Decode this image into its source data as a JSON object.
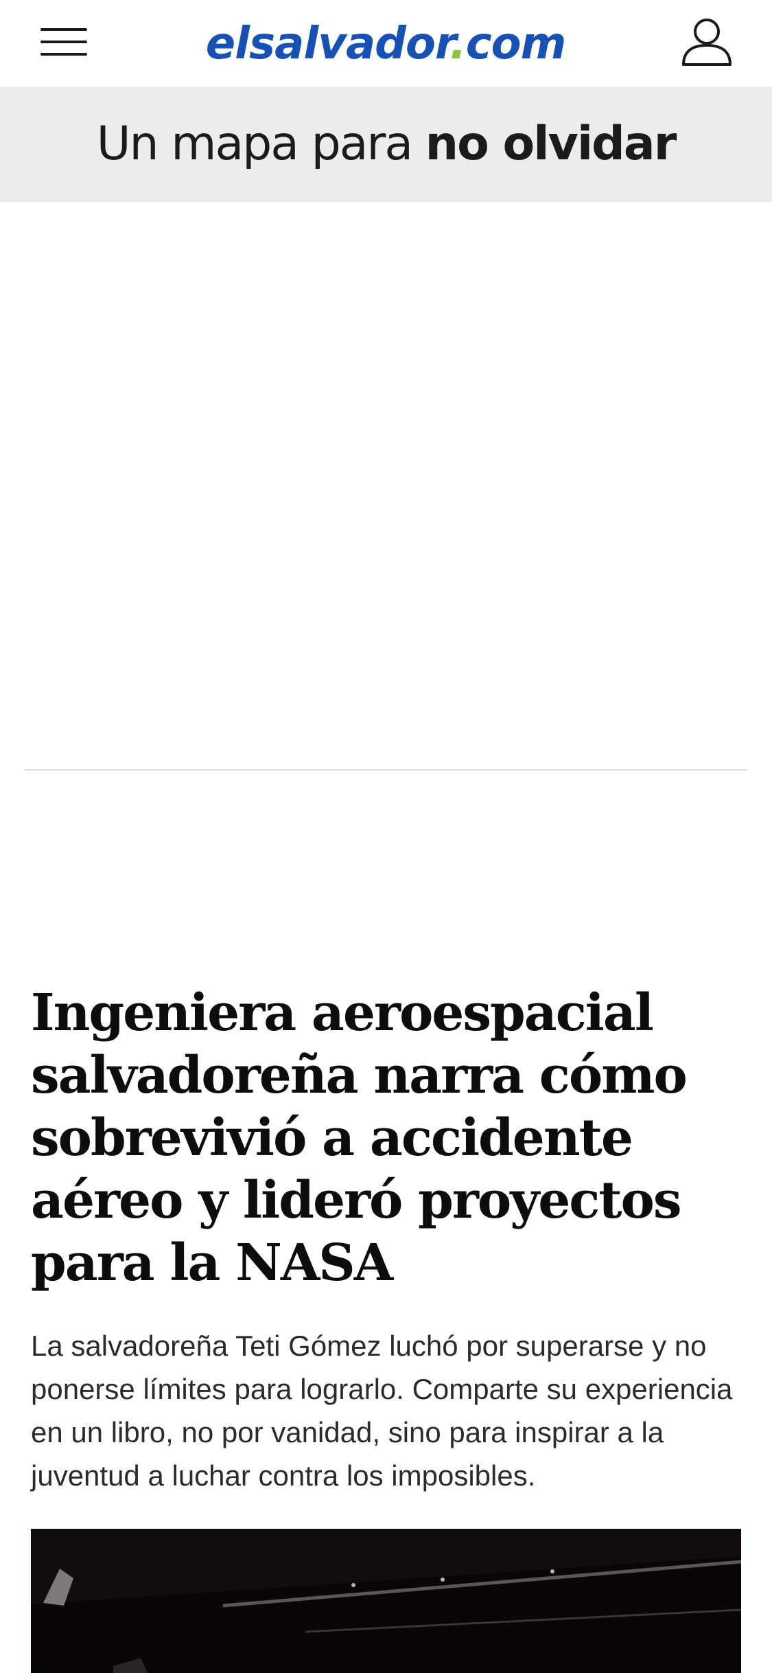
{
  "header": {
    "menu_icon": "hamburger-menu-icon",
    "logo": {
      "text_main": "elsalvador",
      "text_dot": ".",
      "text_tld": "com"
    },
    "user_icon": "user-profile-icon",
    "colors": {
      "logo_blue": "#1652b5",
      "logo_dot_green": "#8cc63f"
    }
  },
  "promo_banner": {
    "text_regular": "Un mapa para ",
    "text_bold": "no olvidar",
    "background": "#ececec"
  },
  "article": {
    "headline": "Ingeniera aeroespacial salvadoreña narra cómo sobrevivió a accidente aéreo y lideró proyectos para la NASA",
    "summary": "La salvadoreña Teti Gómez luchó por superarse y no ponerse límites para lograrlo. Comparte su experiencia en un libro, no por vanidad, sino para inspirar a la juventud a luchar contra los imposibles."
  }
}
